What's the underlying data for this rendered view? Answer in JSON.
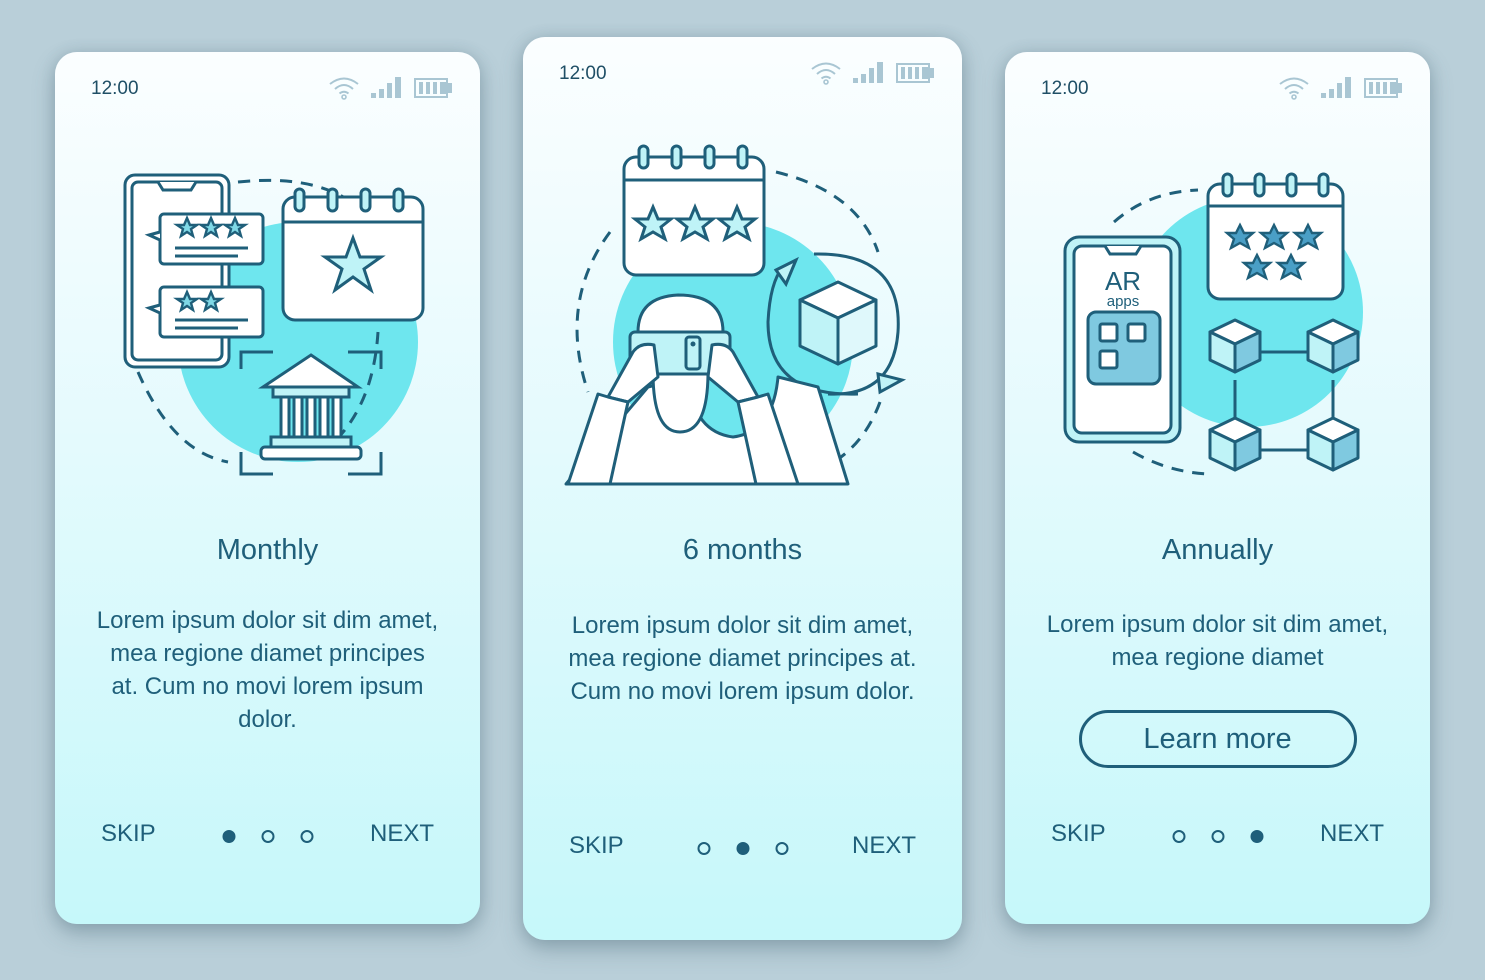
{
  "colors": {
    "background": "#b9cfd9",
    "primary": "#1f5f7a",
    "accent": "#6ee6ee",
    "status_icons": "#a9c6d3"
  },
  "screens": [
    {
      "status": {
        "time": "12:00",
        "icons": [
          "wifi-icon",
          "signal-icon",
          "battery-icon"
        ]
      },
      "illustration": "ratings-app-calendar-bank",
      "title": "Monthly",
      "body": "Lorem ipsum dolor sit dim amet, mea regione diamet principes at. Cum no movi lorem ipsum dolor.",
      "skip_label": "SKIP",
      "next_label": "NEXT",
      "pagination": {
        "current": 1,
        "total": 3
      }
    },
    {
      "status": {
        "time": "12:00",
        "icons": [
          "wifi-icon",
          "signal-icon",
          "battery-icon"
        ]
      },
      "illustration": "person-ar-phone-cube",
      "title": "6 months",
      "body": "Lorem ipsum dolor sit dim amet, mea regione diamet principes at. Cum no movi lorem ipsum dolor.",
      "skip_label": "SKIP",
      "next_label": "NEXT",
      "pagination": {
        "current": 2,
        "total": 3
      }
    },
    {
      "status": {
        "time": "12:00",
        "icons": [
          "wifi-icon",
          "signal-icon",
          "battery-icon"
        ]
      },
      "illustration": "ar-apps-phone-blocks",
      "phone_text": {
        "line1": "AR",
        "line2": "apps"
      },
      "title": "Annually",
      "body": "Lorem ipsum dolor sit dim amet, mea regione diamet",
      "button_label": "Learn more",
      "skip_label": "SKIP",
      "next_label": "NEXT",
      "pagination": {
        "current": 3,
        "total": 3
      }
    }
  ]
}
